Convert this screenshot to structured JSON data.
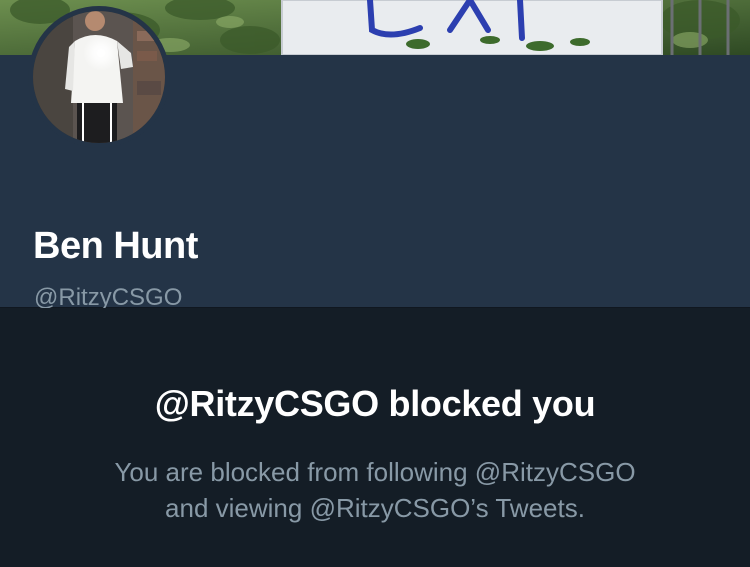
{
  "profile": {
    "display_name": "Ben Hunt",
    "handle": "@RitzyCSGO"
  },
  "blocked": {
    "title": "@RitzyCSGO blocked you",
    "line_1": "You are blocked from following @RitzyCSGO",
    "line_2": "and viewing @RitzyCSGO’s Tweets."
  },
  "icons": {
    "avatar": "profile-photo",
    "banner": "header-photo"
  },
  "colors": {
    "header_background": "#243447",
    "page_background": "#141d26",
    "primary_text": "#ffffff",
    "secondary_text": "#8899a6"
  }
}
